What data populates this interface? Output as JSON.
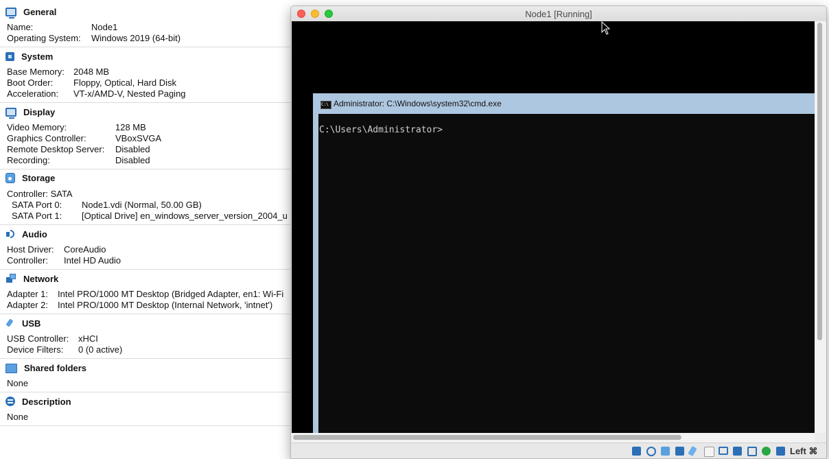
{
  "details": {
    "general": {
      "title": "General",
      "rows": [
        {
          "key": "Name:",
          "value": "Node1"
        },
        {
          "key": "Operating System:",
          "value": "Windows 2019 (64-bit)"
        }
      ]
    },
    "system": {
      "title": "System",
      "rows": [
        {
          "key": "Base Memory:",
          "value": "2048 MB"
        },
        {
          "key": "Boot Order:",
          "value": "Floppy, Optical, Hard Disk"
        },
        {
          "key": "Acceleration:",
          "value": "VT-x/AMD-V, Nested Paging"
        }
      ]
    },
    "display": {
      "title": "Display",
      "rows": [
        {
          "key": "Video Memory:",
          "value": "128 MB"
        },
        {
          "key": "Graphics Controller:",
          "value": "VBoxSVGA"
        },
        {
          "key": "Remote Desktop Server:",
          "value": "Disabled"
        },
        {
          "key": "Recording:",
          "value": "Disabled"
        }
      ]
    },
    "storage": {
      "title": "Storage",
      "controller": "Controller: SATA",
      "rows": [
        {
          "key": "SATA Port 0:",
          "value": "Node1.vdi (Normal, 50.00 GB)"
        },
        {
          "key": "SATA Port 1:",
          "value": "[Optical Drive] en_windows_server_version_2004_u"
        }
      ]
    },
    "audio": {
      "title": "Audio",
      "rows": [
        {
          "key": "Host Driver:",
          "value": "CoreAudio"
        },
        {
          "key": "Controller:",
          "value": "Intel HD Audio"
        }
      ]
    },
    "network": {
      "title": "Network",
      "rows": [
        {
          "key": "Adapter 1:",
          "value": "Intel PRO/1000 MT Desktop (Bridged Adapter, en1: Wi-Fi"
        },
        {
          "key": "Adapter 2:",
          "value": "Intel PRO/1000 MT Desktop (Internal Network, 'intnet')"
        }
      ]
    },
    "usb": {
      "title": "USB",
      "rows": [
        {
          "key": "USB Controller:",
          "value": "xHCI"
        },
        {
          "key": "Device Filters:",
          "value": "0 (0 active)"
        }
      ]
    },
    "shared_folders": {
      "title": "Shared folders",
      "value": "None"
    },
    "description": {
      "title": "Description",
      "value": "None"
    }
  },
  "vm_window": {
    "title": "Node1 [Running]",
    "cmd": {
      "title": "Administrator: C:\\Windows\\system32\\cmd.exe",
      "icon_text": "C:\\",
      "prompt": "C:\\Users\\Administrator>"
    },
    "status": {
      "host_key": "Left ⌘",
      "icons": [
        "hard-disk-icon",
        "optical-drive-icon",
        "audio-icon",
        "network-icon",
        "usb-icon",
        "shared-folders-icon",
        "display-icon",
        "video-capture-icon",
        "cpu-icon",
        "virtualization-icon",
        "mouse-integration-icon",
        "keyboard-capture-icon"
      ]
    }
  },
  "colors": {
    "accent": "#2b6fb6",
    "cmd_titlebar": "#aec7e0",
    "console_bg": "#0c0c0c",
    "close": "#fe5f57",
    "minimize": "#febc2e",
    "zoom": "#28c840"
  }
}
